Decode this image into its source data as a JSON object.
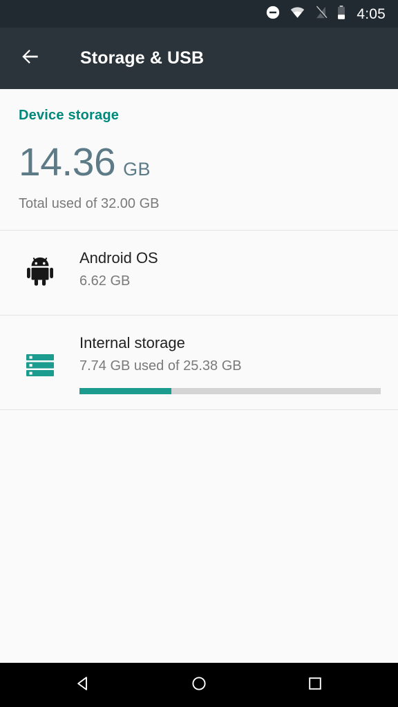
{
  "status_bar": {
    "icons": [
      {
        "name": "do-not-disturb-icon",
        "label": "Do not disturb"
      },
      {
        "name": "wifi-icon",
        "label": "Wi-Fi"
      },
      {
        "name": "cellular-off-icon",
        "label": "No SIM"
      },
      {
        "name": "battery-icon",
        "label": "Battery"
      }
    ],
    "clock": "4:05"
  },
  "app_bar": {
    "back_icon": "arrow-back-icon",
    "title": "Storage & USB"
  },
  "summary": {
    "section_header": "Device storage",
    "used_value": "14.36",
    "used_unit": "GB",
    "total_text": "Total used of 32.00 GB"
  },
  "rows": [
    {
      "icon": "android-robot-icon",
      "title": "Android OS",
      "subtitle": "6.62 GB",
      "has_progress": false
    },
    {
      "icon": "internal-storage-icon",
      "title": "Internal storage",
      "subtitle": "7.74 GB used of 25.38 GB",
      "has_progress": true,
      "progress_percent": 30.5
    }
  ],
  "nav_bar": {
    "back": "back-triangle-icon",
    "home": "home-circle-icon",
    "recents": "recents-square-icon"
  },
  "colors": {
    "accent_teal": "#00897b",
    "progress_teal": "#1c9c8e",
    "app_bar": "#2b343b",
    "status_bar": "#212a30",
    "summary_number": "#5d7a87",
    "background": "#fafafa",
    "secondary_text": "#7a7a7a"
  }
}
